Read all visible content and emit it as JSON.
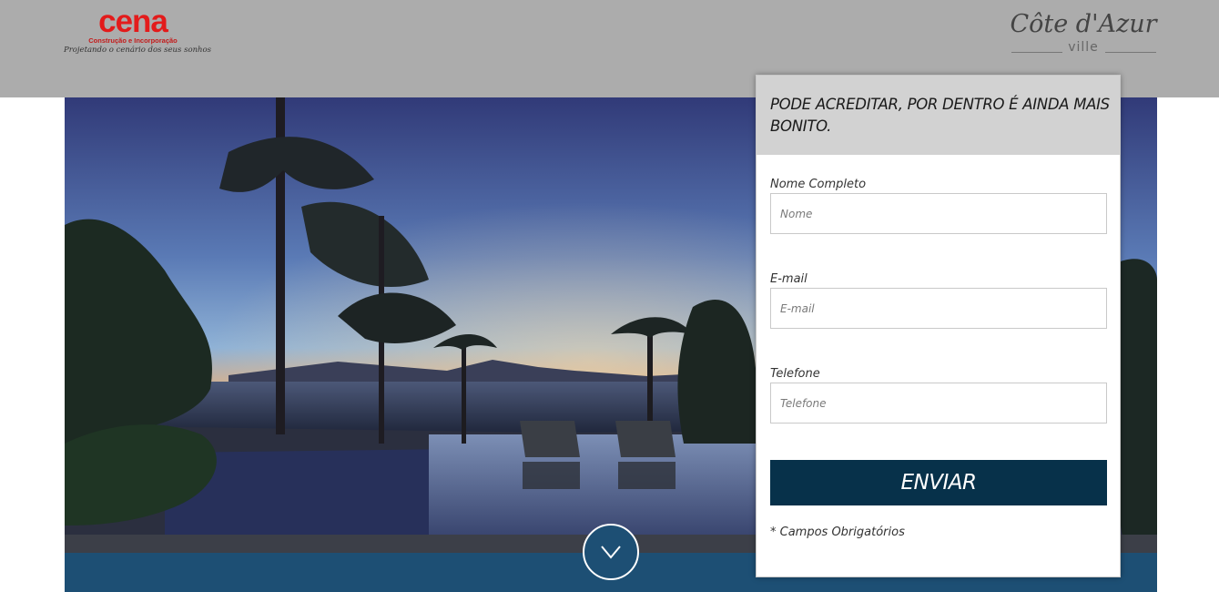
{
  "header": {
    "logo_left": {
      "name": "cena",
      "subtitle": "Construção e Incorporação",
      "tagline": "Projetando o cenário dos seus sonhos",
      "brand_color": "#e31b1b"
    },
    "logo_right": {
      "name": "Côte d'Azur",
      "subtitle": "ville"
    }
  },
  "hero": {
    "image_description": "sunset-pool-ocean-photo",
    "scroll_icon": "chevron-down-icon"
  },
  "form": {
    "title": "PODE ACREDITAR, POR DENTRO É AINDA MAIS BONITO.",
    "fields": [
      {
        "label": "Nome Completo",
        "placeholder": "Nome",
        "value": ""
      },
      {
        "label": "E-mail",
        "placeholder": "E-mail",
        "value": ""
      },
      {
        "label": "Telefone",
        "placeholder": "Telefone",
        "value": ""
      }
    ],
    "submit_label": "ENVIAR",
    "required_note": "* Campos Obrigatórios"
  },
  "colors": {
    "header_bg": "#acacac",
    "accent_dark": "#07314a",
    "band_blue": "#1d4f74"
  }
}
